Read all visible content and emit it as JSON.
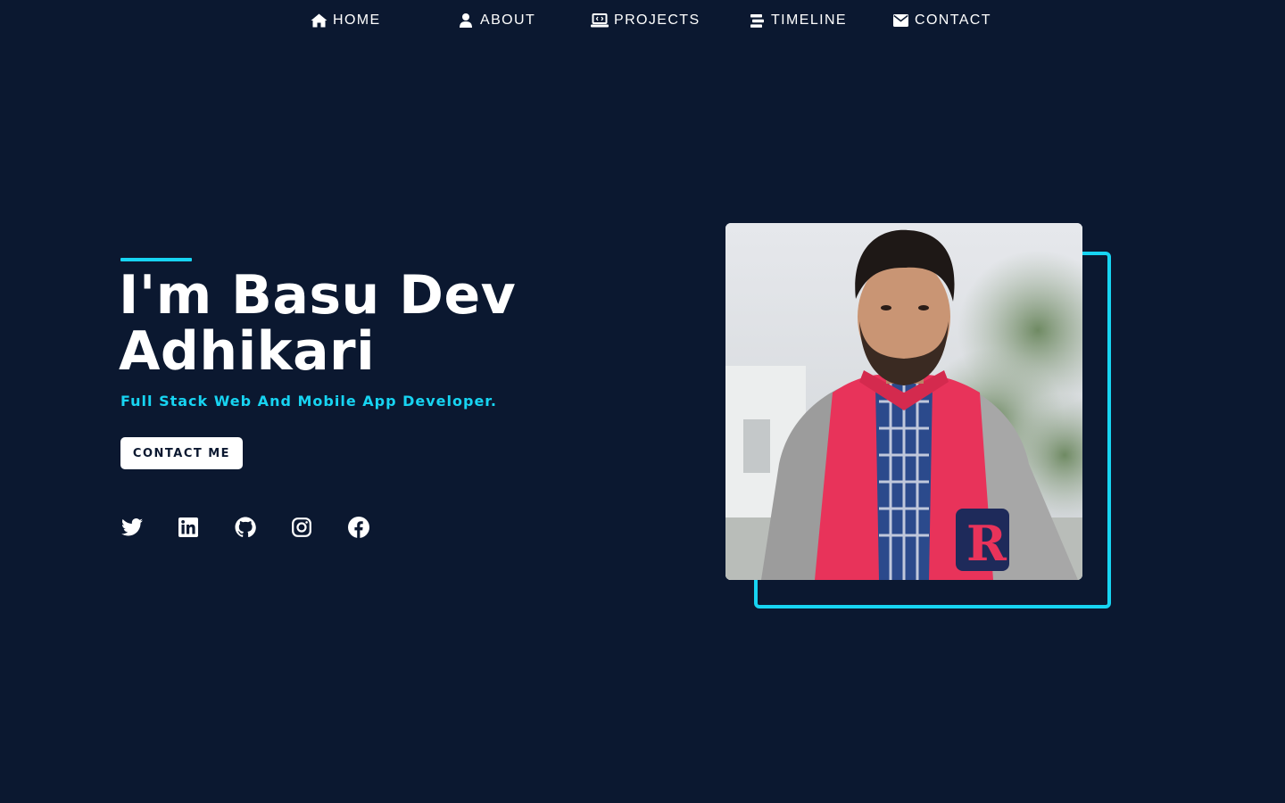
{
  "nav": {
    "items": [
      {
        "label": "HOME",
        "icon": "home-icon"
      },
      {
        "label": "ABOUT",
        "icon": "user-icon"
      },
      {
        "label": "PROJECTS",
        "icon": "laptop-code-icon"
      },
      {
        "label": "TIMELINE",
        "icon": "stream-icon"
      },
      {
        "label": "CONTACT",
        "icon": "envelope-icon"
      }
    ]
  },
  "hero": {
    "title_line1": "I'm Basu Dev",
    "title_line2": "Adhikari",
    "subtitle": "Full Stack Web And Mobile App Developer.",
    "contact_button": "CONTACT ME"
  },
  "socials": [
    {
      "name": "twitter",
      "icon": "twitter-icon"
    },
    {
      "name": "linkedin",
      "icon": "linkedin-icon"
    },
    {
      "name": "github",
      "icon": "github-icon"
    },
    {
      "name": "instagram",
      "icon": "instagram-icon"
    },
    {
      "name": "facebook",
      "icon": "facebook-icon"
    }
  ],
  "photo": {
    "frame_color": "#17d4f2"
  },
  "colors": {
    "background": "#0b1830",
    "accent": "#17d4f2",
    "text": "#ffffff"
  }
}
